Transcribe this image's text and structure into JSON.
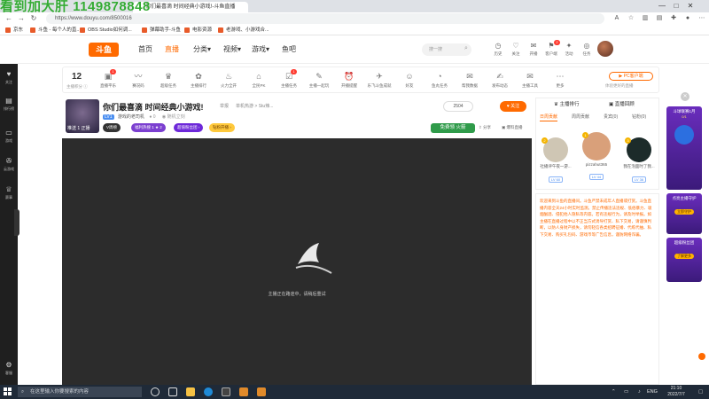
{
  "overlay": {
    "watermark": "看到加大肝 1149878848"
  },
  "browser": {
    "tabs": [
      {
        "title": "你们最喜滴 时间经典小游戏!-斗鱼直播"
      },
      {
        "title": ""
      }
    ],
    "url": "https://www.douyu.com/8500016",
    "bookmarks": [
      "京东",
      "斗鱼 - 每个人的直...",
      "OBS Studio如何调...",
      "弹幕助手-斗鱼",
      "电影资源",
      "老游戏、小游戏合..."
    ],
    "window_controls": {
      "minimize": "—",
      "maximize": "□",
      "close": "✕"
    }
  },
  "site": {
    "logo": "斗鱼",
    "nav": [
      {
        "label": "首页",
        "active": false
      },
      {
        "label": "直播",
        "active": true
      },
      {
        "label": "分类▾",
        "active": false
      },
      {
        "label": "视频▾",
        "active": false
      },
      {
        "label": "游戏▾",
        "active": false
      },
      {
        "label": "鱼吧",
        "active": false
      }
    ],
    "search_placeholder": "搜一搜",
    "header_icons": [
      {
        "glyph": "◷",
        "label": "历史",
        "badge": ""
      },
      {
        "glyph": "♡",
        "label": "关注",
        "badge": ""
      },
      {
        "glyph": "✉",
        "label": "开播",
        "badge": ""
      },
      {
        "glyph": "⚑",
        "label": "客户端",
        "badge": "2"
      },
      {
        "glyph": "✦",
        "label": "活动",
        "badge": ""
      },
      {
        "glyph": "◎",
        "label": "任务",
        "badge": ""
      },
      {
        "glyph": "⌖",
        "label": "定位中心",
        "badge": ""
      }
    ]
  },
  "sidebar": [
    {
      "glyph": "♥",
      "label": "关注"
    },
    {
      "glyph": "▤",
      "label": "排行榜"
    },
    {
      "glyph": "▭",
      "label": "游戏"
    },
    {
      "glyph": "✇",
      "label": "云游戏"
    },
    {
      "glyph": "♕",
      "label": "赛事"
    },
    {
      "glyph": "⚙",
      "label": "客服"
    }
  ],
  "category_bar": {
    "rank_number": "12",
    "rank_label": "主播积分 ⓘ",
    "items": [
      {
        "glyph": "▣",
        "label": "直播平乐",
        "badge": "1"
      },
      {
        "glyph": "〰",
        "label": "赛况码",
        "badge": ""
      },
      {
        "glyph": "♛",
        "label": "超级任务",
        "badge": ""
      },
      {
        "glyph": "✿",
        "label": "主播排行",
        "badge": ""
      },
      {
        "glyph": "♨",
        "label": "火力全开",
        "badge": ""
      },
      {
        "glyph": "⌂",
        "label": "全民PK",
        "badge": ""
      },
      {
        "glyph": "☑",
        "label": "主播任务",
        "badge": "1"
      },
      {
        "glyph": "✎",
        "label": "主播一起玩",
        "badge": ""
      },
      {
        "glyph": "⏰",
        "label": "开播提醒",
        "badge": ""
      },
      {
        "glyph": "✈",
        "label": "乐飞斗鱼成就",
        "badge": ""
      },
      {
        "glyph": "☺",
        "label": "好友",
        "badge": ""
      },
      {
        "glyph": "◔",
        "label": "鱼丸任务",
        "badge": ""
      },
      {
        "glyph": "✉",
        "label": "帮我数据",
        "badge": ""
      },
      {
        "glyph": "✍",
        "label": "发布动态",
        "badge": ""
      },
      {
        "glyph": "✉",
        "label": "主播工具",
        "badge": ""
      },
      {
        "glyph": "⋯",
        "label": "更多",
        "badge": ""
      }
    ],
    "pc_client": "▶ PC客户端",
    "pc_client_sub": "体验更好的直播"
  },
  "room": {
    "title": "你们最喜滴 时间经典小游戏!",
    "report": "举报",
    "category": "单机热游 > Stu辣...",
    "views": "2504",
    "follow": "♥ 关注",
    "level": "LV1",
    "streamer_name": "游戏的老司机",
    "fans": "● 0",
    "extra": "◉ 随机立刻",
    "avatar_label": "推送 1  正播",
    "pills": [
      {
        "label": "V周榜",
        "bg": "#333",
        "fg": "#fff"
      },
      {
        "label": "福利热搜 1 ★ 2",
        "bg": "#7b3fd0",
        "fg": "#fff"
      },
      {
        "label": "超值粉丝团 ›",
        "bg": "#6d28d9",
        "fg": "#fff"
      },
      {
        "label": "钻粉开播 ›",
        "bg": "#ffc93c",
        "fg": "#6a3b00"
      }
    ],
    "free_gift": "免费领 火箭",
    "share": "⇪ 分享",
    "client": "▣ 爆料直播"
  },
  "player": {
    "status": "主播正在路途中，请稍后重试"
  },
  "rank_panel": {
    "header_left": "♛ 主播排行",
    "header_right": "▣ 直播回顾",
    "tabs": [
      {
        "label": "日周贡献",
        "active": true
      },
      {
        "label": "周周贡献",
        "active": false
      },
      {
        "label": "贵宾(0)",
        "active": false
      },
      {
        "label": "钻粉(0)",
        "active": false
      }
    ],
    "users": [
      {
        "rank": "2",
        "name": "社播评午夜一游...",
        "level": "LV 60",
        "avatar_color": "#cfc6b4"
      },
      {
        "rank": "1",
        "name": "pizzahut365",
        "level": "LV 44",
        "avatar_color": "#d9a07a"
      },
      {
        "rank": "3",
        "name": "我在泡面时了我...",
        "level": "LV 36",
        "avatar_color": "#1c2b2a"
      }
    ]
  },
  "chat": {
    "notice": "欢迎来到斗鱼的直播间。斗鱼严禁未成年人直播或打赏。斗鱼直播内容全天24小时实时监测。禁止传播违法违规、低俗暴力、吸烟酗酒、侵犯他人隐私等内容。若有违规行为，请及时举报。如主播在直播过程中以不正当方式诱导打赏、私下交易，请谨慎判断，以防人身财产损失，请勿轻信各类招聘征婚、代练代抽、私下交易、购买礼包码、游戏币等广告信息，谨防网络诈骗。"
  },
  "promos": [
    {
      "title": "斗球联赛1月",
      "sub": "0/1",
      "button": ""
    },
    {
      "title": "点亮主播守护",
      "sub": "",
      "button": "立即守护"
    },
    {
      "title": "超级粉丝团",
      "sub": "",
      "button": "了解更多"
    }
  ],
  "taskbar": {
    "search_placeholder": "在这里输入你要搜索的内容",
    "tray_lang": "ENG",
    "time": "21:10",
    "date": "2022/7/7"
  }
}
